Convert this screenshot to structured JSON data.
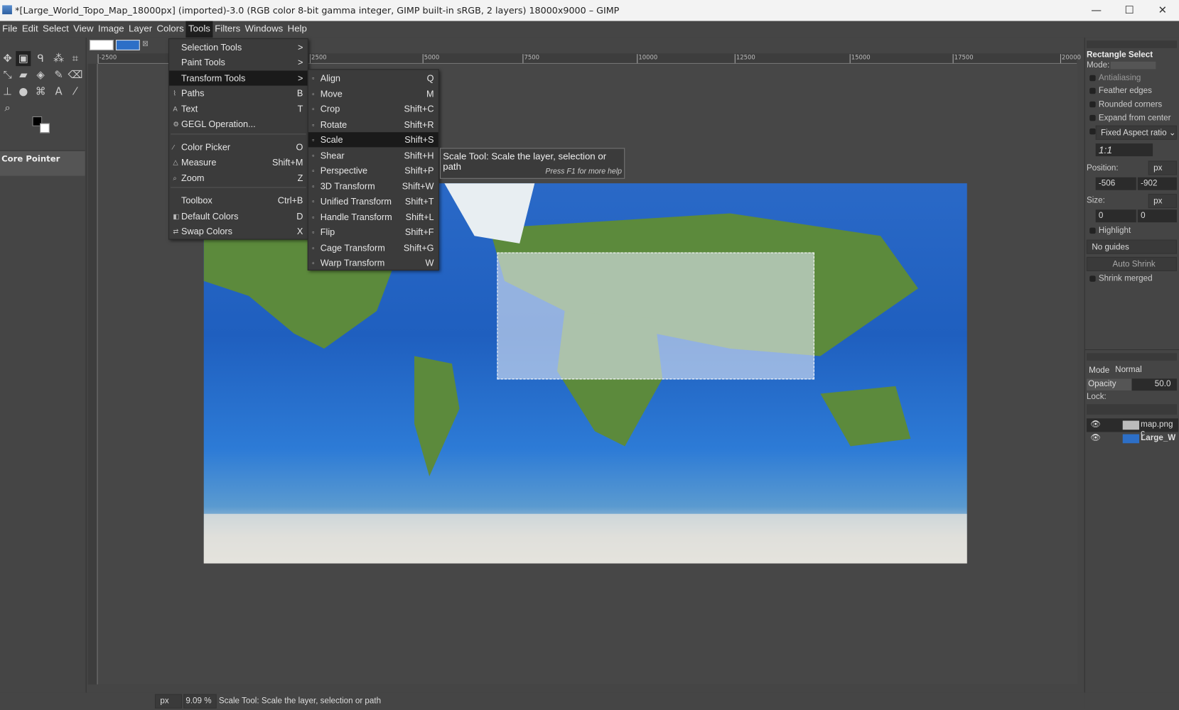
{
  "window": {
    "title": "*[Large_World_Topo_Map_18000px] (imported)-3.0 (RGB color 8-bit gamma integer, GIMP built-in sRGB, 2 layers) 18000x9000 – GIMP",
    "minimize": "—",
    "maximize": "☐",
    "close": "✕"
  },
  "menubar": [
    "File",
    "Edit",
    "Select",
    "View",
    "Image",
    "Layer",
    "Colors",
    "Tools",
    "Filters",
    "Windows",
    "Help"
  ],
  "tools_menu": [
    {
      "label": "Selection Tools",
      "shortcut": ">",
      "icon": ""
    },
    {
      "label": "Paint Tools",
      "shortcut": ">",
      "icon": ""
    },
    {
      "label": "Transform Tools",
      "shortcut": ">",
      "icon": "",
      "active": true
    },
    {
      "label": "Paths",
      "shortcut": "B",
      "icon": "paths-icon"
    },
    {
      "label": "Text",
      "shortcut": "T",
      "icon": "text-icon"
    },
    {
      "label": "GEGL Operation...",
      "shortcut": "",
      "icon": "gegl-icon"
    },
    {
      "label": "Color Picker",
      "shortcut": "O",
      "icon": "color-picker-icon"
    },
    {
      "label": "Measure",
      "shortcut": "Shift+M",
      "icon": "measure-icon"
    },
    {
      "label": "Zoom",
      "shortcut": "Z",
      "icon": "zoom-icon"
    },
    {
      "label": "Toolbox",
      "shortcut": "Ctrl+B",
      "icon": ""
    },
    {
      "label": "Default Colors",
      "shortcut": "D",
      "icon": "default-colors-icon"
    },
    {
      "label": "Swap Colors",
      "shortcut": "X",
      "icon": "swap-colors-icon"
    }
  ],
  "transform_menu": [
    {
      "label": "Align",
      "shortcut": "Q"
    },
    {
      "label": "Move",
      "shortcut": "M"
    },
    {
      "label": "Crop",
      "shortcut": "Shift+C"
    },
    {
      "label": "Rotate",
      "shortcut": "Shift+R"
    },
    {
      "label": "Scale",
      "shortcut": "Shift+S",
      "active": true
    },
    {
      "label": "Shear",
      "shortcut": "Shift+H"
    },
    {
      "label": "Perspective",
      "shortcut": "Shift+P"
    },
    {
      "label": "3D Transform",
      "shortcut": "Shift+W"
    },
    {
      "label": "Unified Transform",
      "shortcut": "Shift+T"
    },
    {
      "label": "Handle Transform",
      "shortcut": "Shift+L"
    },
    {
      "label": "Flip",
      "shortcut": "Shift+F"
    },
    {
      "label": "Cage Transform",
      "shortcut": "Shift+G"
    },
    {
      "label": "Warp Transform",
      "shortcut": "W"
    }
  ],
  "tooltip": {
    "text": "Scale Tool: Scale the layer, selection or path",
    "help": "Press F1 for more help"
  },
  "ruler": [
    "-2500",
    "2500",
    "5000",
    "7500",
    "10000",
    "12500",
    "15000",
    "17500",
    "20000"
  ],
  "left_panel": {
    "device_status": "Core Pointer"
  },
  "tool_options": {
    "title": "Rectangle Select",
    "mode_label": "Mode:",
    "antialiasing": "Antialiasing",
    "feather": "Feather edges",
    "rounded": "Rounded corners",
    "expand": "Expand from center",
    "fixed": "Fixed",
    "aspect": "Aspect ratio",
    "ratio": "1:1",
    "position_label": "Position:",
    "unit": "px",
    "pos_x": "-506",
    "pos_y": "-902",
    "size_label": "Size:",
    "size_w": "0",
    "size_h": "0",
    "highlight": "Highlight",
    "guides": "No guides",
    "auto_shrink": "Auto Shrink",
    "shrink_merged": "Shrink merged"
  },
  "layers": {
    "mode_label": "Mode",
    "mode": "Normal",
    "opacity_label": "Opacity",
    "opacity": "50.0",
    "lock_label": "Lock:",
    "items": [
      {
        "name": "map.png c"
      },
      {
        "name": "Large_W"
      }
    ]
  },
  "status": {
    "unit": "px",
    "zoom": "9.09 %",
    "message": "Scale Tool: Scale the layer, selection or path"
  },
  "colors": {
    "accent_highlight": "#1a1a1a",
    "panel": "#454545"
  }
}
